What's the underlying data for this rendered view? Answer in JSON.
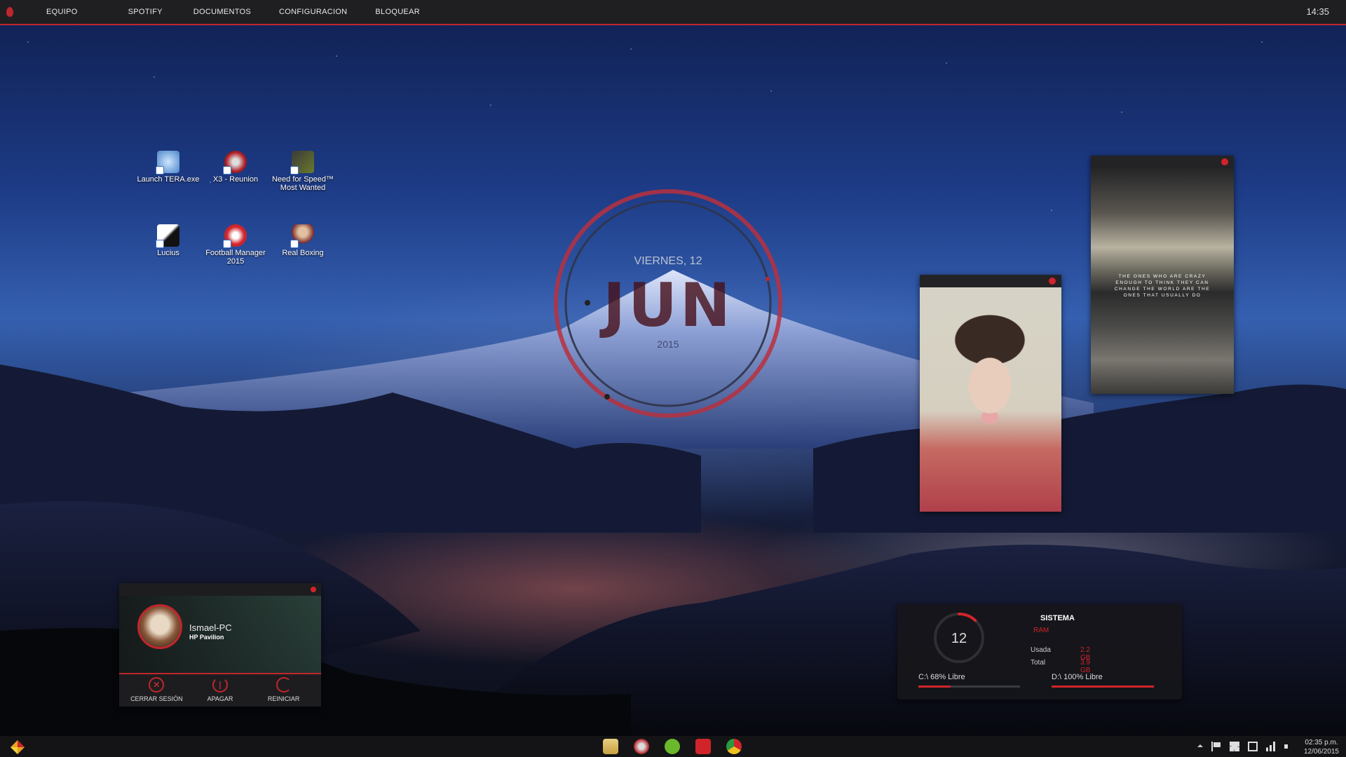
{
  "topbar": {
    "menu": [
      "EQUIPO",
      "SPOTIFY",
      "DOCUMENTOS",
      "CONFIGURACION",
      "BLOQUEAR"
    ],
    "clock": "14:35",
    "accent": "#c0262c"
  },
  "desktop_icons": [
    {
      "label": "Launch TERA.exe",
      "icon": "tera-icon"
    },
    {
      "label": "X3 - Reunion",
      "icon": "x3-reunion-icon"
    },
    {
      "label": "Need for Speed™ Most Wanted",
      "icon": "nfs-most-wanted-icon"
    },
    {
      "label": "Lucius",
      "icon": "lucius-icon"
    },
    {
      "label": "Football Manager 2015",
      "icon": "football-manager-icon"
    },
    {
      "label": "Real Boxing",
      "icon": "real-boxing-icon"
    }
  ],
  "date_widget": {
    "weekday": "VIERNES, 12",
    "month": "JUN",
    "year": "2015"
  },
  "photo_widgets": {
    "quote": "THE ONES WHO ARE CRAZY ENOUGH TO THINK THEY CAN CHANGE THE WORLD ARE THE ONES THAT USUALLY DO"
  },
  "user_widget": {
    "pc_name": "Ismael-PC",
    "pc_model": "HP Pavilion",
    "actions": [
      "CERRAR SESIÓN",
      "APAGAR",
      "REINICIAR"
    ]
  },
  "system_widget": {
    "gauge_value": "12",
    "gauge_fraction": 0.12,
    "title": "SISTEMA",
    "ram_label": "RAM",
    "used_label": "Usada",
    "used_value": "2.2 GB",
    "total_label": "Total",
    "total_value": "3.9 GB",
    "drive_c": "C:\\ 68% Libre",
    "drive_c_fraction": 0.32,
    "drive_d": "D:\\ 100% Libre",
    "drive_d_fraction": 1.0
  },
  "taskbar": {
    "apps": [
      "file-explorer-icon",
      "x3-icon",
      "spotify-icon",
      "vivaldi-icon",
      "chrome-icon"
    ],
    "time": "02:35 p.m.",
    "date": "12/06/2015"
  }
}
